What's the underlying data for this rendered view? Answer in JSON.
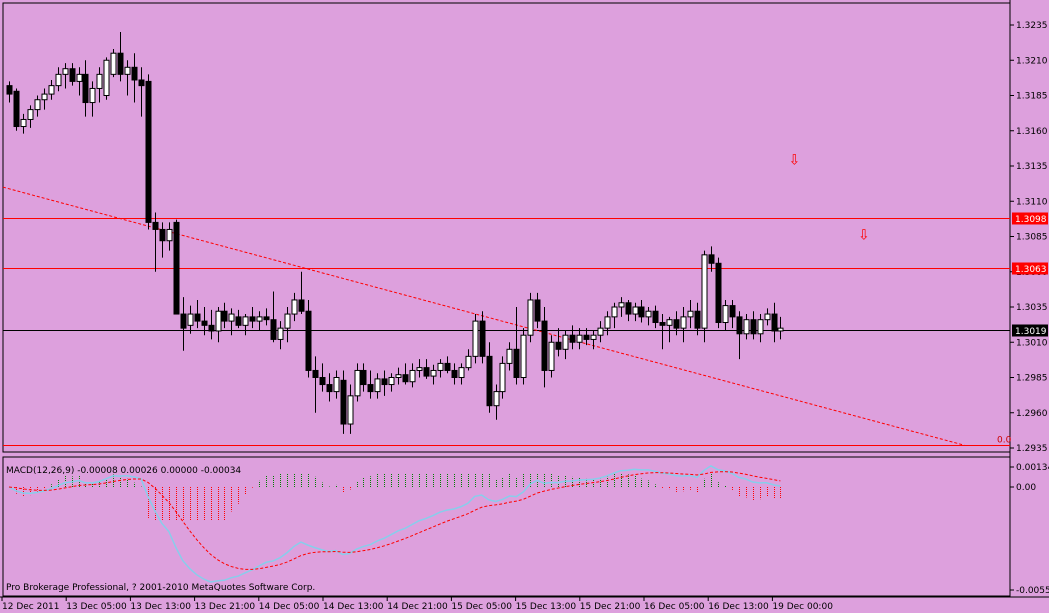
{
  "chart_data": {
    "type": "candlestick",
    "symbol_period": "",
    "price_axis": {
      "ticks": [
        "1.3235",
        "1.3210",
        "1.3185",
        "1.3160",
        "1.3135",
        "1.3110",
        "1.3085",
        "1.3060",
        "1.3035",
        "1.3010",
        "1.2985",
        "1.2960",
        "1.2935"
      ],
      "range": [
        1.293,
        1.326
      ]
    },
    "time_axis": {
      "labels": [
        "12 Dec 2011",
        "13 Dec 05:00",
        "13 Dec 13:00",
        "13 Dec 21:00",
        "14 Dec 05:00",
        "14 Dec 13:00",
        "14 Dec 21:00",
        "15 Dec 05:00",
        "15 Dec 13:00",
        "15 Dec 21:00",
        "16 Dec 05:00",
        "16 Dec 13:00",
        "19 Dec 00:00"
      ]
    },
    "levels": [
      {
        "value": 1.3098,
        "label": "1.3098",
        "color": "#ff0000"
      },
      {
        "value": 1.3063,
        "label": "1.3063",
        "color": "#ff0000"
      },
      {
        "value": 1.3019,
        "label": "1.3019",
        "color": "#000000"
      }
    ],
    "fib_line": {
      "value": 1.2937,
      "label": "0.0",
      "color": "#ff0000"
    },
    "trendline": {
      "from": {
        "bar": 0,
        "price": 1.312
      },
      "to": {
        "bar": 136,
        "price": 1.2937
      },
      "color": "#ff0000",
      "style": "dashed"
    },
    "arrows": [
      {
        "bar": 113,
        "price": 1.3136,
        "glyph": "⇩",
        "color": "#ff0000"
      },
      {
        "bar": 123,
        "price": 1.3083,
        "glyph": "⇩",
        "color": "#ff0000"
      }
    ],
    "candles": [
      [
        1.3192,
        1.3195,
        1.318,
        1.3186
      ],
      [
        1.3188,
        1.319,
        1.316,
        1.3163
      ],
      [
        1.3163,
        1.3172,
        1.3158,
        1.3168
      ],
      [
        1.3168,
        1.3178,
        1.3162,
        1.3175
      ],
      [
        1.3175,
        1.3185,
        1.317,
        1.3182
      ],
      [
        1.3182,
        1.319,
        1.3175,
        1.3186
      ],
      [
        1.3186,
        1.3196,
        1.3182,
        1.3192
      ],
      [
        1.3192,
        1.3205,
        1.3188,
        1.32
      ],
      [
        1.32,
        1.3208,
        1.319,
        1.3204
      ],
      [
        1.3204,
        1.3208,
        1.3192,
        1.3195
      ],
      [
        1.3195,
        1.3205,
        1.3185,
        1.32
      ],
      [
        1.32,
        1.321,
        1.317,
        1.318
      ],
      [
        1.318,
        1.3195,
        1.317,
        1.319
      ],
      [
        1.319,
        1.3205,
        1.318,
        1.32
      ],
      [
        1.3185,
        1.3212,
        1.3182,
        1.321
      ],
      [
        1.32,
        1.3218,
        1.3198,
        1.3215
      ],
      [
        1.3215,
        1.323,
        1.3195,
        1.32
      ],
      [
        1.32,
        1.321,
        1.3185,
        1.3205
      ],
      [
        1.3205,
        1.3215,
        1.318,
        1.3196
      ],
      [
        1.3196,
        1.3205,
        1.317,
        1.3192
      ],
      [
        1.3195,
        1.32,
        1.309,
        1.3095
      ],
      [
        1.3095,
        1.3102,
        1.306,
        1.309
      ],
      [
        1.309,
        1.3095,
        1.307,
        1.3082
      ],
      [
        1.3082,
        1.3095,
        1.3075,
        1.309
      ],
      [
        1.3095,
        1.3097,
        1.3055,
        1.303
      ],
      [
        1.303,
        1.3042,
        1.3004,
        1.302
      ],
      [
        1.3022,
        1.3036,
        1.3016,
        1.303
      ],
      [
        1.303,
        1.304,
        1.302,
        1.3025
      ],
      [
        1.3025,
        1.3035,
        1.3015,
        1.3022
      ],
      [
        1.3022,
        1.3033,
        1.3012,
        1.3018
      ],
      [
        1.3018,
        1.3035,
        1.301,
        1.3032
      ],
      [
        1.3032,
        1.3038,
        1.302,
        1.3025
      ],
      [
        1.3025,
        1.3034,
        1.3015,
        1.303
      ],
      [
        1.3028,
        1.3033,
        1.302,
        1.3022
      ],
      [
        1.3022,
        1.303,
        1.3015,
        1.3028
      ],
      [
        1.3028,
        1.3035,
        1.302,
        1.3025
      ],
      [
        1.3025,
        1.3032,
        1.3018,
        1.3028
      ],
      [
        1.3028,
        1.3034,
        1.3022,
        1.3026
      ],
      [
        1.3026,
        1.3046,
        1.301,
        1.3012
      ],
      [
        1.3012,
        1.3025,
        1.3005,
        1.302
      ],
      [
        1.302,
        1.3035,
        1.301,
        1.303
      ],
      [
        1.303,
        1.3045,
        1.3025,
        1.304
      ],
      [
        1.304,
        1.306,
        1.303,
        1.3032
      ],
      [
        1.3032,
        1.304,
        1.2985,
        1.299
      ],
      [
        1.299,
        1.3,
        1.296,
        1.2985
      ],
      [
        1.2985,
        1.2995,
        1.2975,
        1.298
      ],
      [
        1.298,
        1.2988,
        1.2968,
        1.2975
      ],
      [
        1.2975,
        1.299,
        1.297,
        1.2985
      ],
      [
        1.2983,
        1.299,
        1.2945,
        1.2952
      ],
      [
        1.2952,
        1.298,
        1.2945,
        1.2972
      ],
      [
        1.2972,
        1.2995,
        1.2968,
        1.299
      ],
      [
        1.299,
        1.2995,
        1.2975,
        1.298
      ],
      [
        1.298,
        1.299,
        1.297,
        1.2975
      ],
      [
        1.2975,
        1.2988,
        1.297,
        1.2984
      ],
      [
        1.2984,
        1.299,
        1.2972,
        1.298
      ],
      [
        1.298,
        1.2988,
        1.2975,
        1.2985
      ],
      [
        1.2985,
        1.2992,
        1.298,
        1.2987
      ],
      [
        1.2987,
        1.2995,
        1.298,
        1.2982
      ],
      [
        1.2982,
        1.2995,
        1.2978,
        1.299
      ],
      [
        1.299,
        1.2998,
        1.2985,
        1.2992
      ],
      [
        1.2992,
        1.2998,
        1.2984,
        1.2986
      ],
      [
        1.2986,
        1.2994,
        1.298,
        1.299
      ],
      [
        1.299,
        1.2998,
        1.2985,
        1.2995
      ],
      [
        1.2995,
        1.3,
        1.2988,
        1.299
      ],
      [
        1.299,
        1.2995,
        1.298,
        1.2985
      ],
      [
        1.2985,
        1.2995,
        1.298,
        1.2992
      ],
      [
        1.2992,
        1.3005,
        1.299,
        1.3
      ],
      [
        1.3,
        1.303,
        1.2995,
        1.3025
      ],
      [
        1.3025,
        1.3032,
        1.2995,
        1.3
      ],
      [
        1.3,
        1.301,
        1.296,
        1.2965
      ],
      [
        1.2965,
        1.298,
        1.2955,
        1.2975
      ],
      [
        1.2975,
        1.3,
        1.297,
        1.2995
      ],
      [
        1.2995,
        1.301,
        1.299,
        1.3005
      ],
      [
        1.3005,
        1.3035,
        1.298,
        1.2985
      ],
      [
        1.2985,
        1.302,
        1.298,
        1.3015
      ],
      [
        1.3015,
        1.3045,
        1.301,
        1.304
      ],
      [
        1.304,
        1.3045,
        1.302,
        1.3025
      ],
      [
        1.3025,
        1.3035,
        1.2978,
        1.299
      ],
      [
        1.299,
        1.3015,
        1.2985,
        1.301
      ],
      [
        1.301,
        1.302,
        1.3,
        1.3005
      ],
      [
        1.3005,
        1.3018,
        1.2998,
        1.3015
      ],
      [
        1.3015,
        1.3022,
        1.3005,
        1.301
      ],
      [
        1.301,
        1.302,
        1.3005,
        1.3015
      ],
      [
        1.3015,
        1.302,
        1.3008,
        1.3012
      ],
      [
        1.3012,
        1.3018,
        1.3005,
        1.3015
      ],
      [
        1.3015,
        1.3025,
        1.301,
        1.302
      ],
      [
        1.302,
        1.3032,
        1.3015,
        1.3028
      ],
      [
        1.3028,
        1.3038,
        1.302,
        1.3035
      ],
      [
        1.3035,
        1.3042,
        1.3028,
        1.3038
      ],
      [
        1.3038,
        1.304,
        1.3025,
        1.303
      ],
      [
        1.303,
        1.3038,
        1.3025,
        1.3035
      ],
      [
        1.3035,
        1.304,
        1.3024,
        1.3028
      ],
      [
        1.3028,
        1.3035,
        1.3022,
        1.3032
      ],
      [
        1.3032,
        1.3036,
        1.302,
        1.3024
      ],
      [
        1.3024,
        1.303,
        1.3005,
        1.3022
      ],
      [
        1.3022,
        1.3028,
        1.301,
        1.3026
      ],
      [
        1.3026,
        1.3032,
        1.3015,
        1.302
      ],
      [
        1.302,
        1.3035,
        1.301,
        1.3028
      ],
      [
        1.3028,
        1.304,
        1.302,
        1.3032
      ],
      [
        1.3032,
        1.3038,
        1.3015,
        1.302
      ],
      [
        1.302,
        1.3075,
        1.301,
        1.3072
      ],
      [
        1.3072,
        1.3078,
        1.306,
        1.3066
      ],
      [
        1.3066,
        1.307,
        1.302,
        1.3024
      ],
      [
        1.3024,
        1.304,
        1.3018,
        1.3036
      ],
      [
        1.3036,
        1.304,
        1.302,
        1.3028
      ],
      [
        1.3028,
        1.3032,
        1.2998,
        1.3016
      ],
      [
        1.3016,
        1.303,
        1.3012,
        1.3026
      ],
      [
        1.3026,
        1.3032,
        1.3012,
        1.3016
      ],
      [
        1.3016,
        1.303,
        1.301,
        1.3026
      ],
      [
        1.3026,
        1.3034,
        1.3022,
        1.303
      ],
      [
        1.303,
        1.3038,
        1.301,
        1.3018
      ],
      [
        1.3018,
        1.3028,
        1.3012,
        1.302
      ]
    ],
    "macd": {
      "label": "MACD(12,26,9) -0.00008 0.00026 0.00000 -0.00034",
      "ticks": [
        "0.00134",
        "0.00",
        "-0.0055"
      ]
    },
    "copyright": "Pro Brokerage Professional, ? 2001-2010 MetaQuotes Software Corp."
  }
}
